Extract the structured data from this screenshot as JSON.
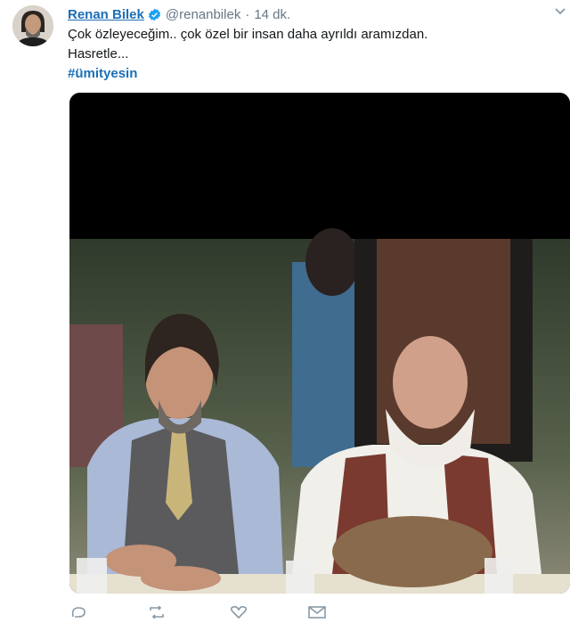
{
  "tweet": {
    "display_name": "Renan Bilek",
    "handle": "@renanbilek",
    "separator": "·",
    "time": "14 dk.",
    "text_line1": "Çok özleyeceğim.. çok özel bir insan daha ayrıldı aramızdan.",
    "text_line2": "Hasretle...",
    "hashtag": "#ümityesin"
  },
  "icons": {
    "verified": "verified-badge-icon",
    "caret": "chevron-down-icon",
    "reply": "reply-icon",
    "retweet": "retweet-icon",
    "like": "heart-icon",
    "dm": "envelope-icon"
  },
  "colors": {
    "link": "#1b6fb5",
    "muted": "#657786",
    "verified": "#1da1f2"
  }
}
